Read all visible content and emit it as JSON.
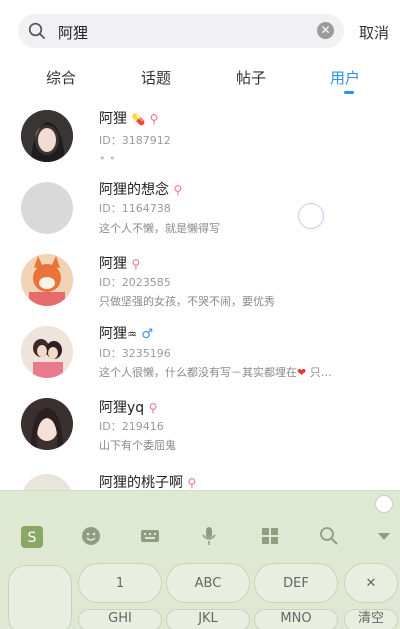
{
  "search": {
    "query": "阿狸",
    "cancel_label": "取消"
  },
  "tabs": [
    {
      "label": "综合",
      "active": false
    },
    {
      "label": "话题",
      "active": false
    },
    {
      "label": "帖子",
      "active": false
    },
    {
      "label": "用户",
      "active": true
    }
  ],
  "users": [
    {
      "name": "阿狸",
      "id": "ID：3187912",
      "bio": "",
      "gender": "female",
      "extra_icon": "pill-icon"
    },
    {
      "name": "阿狸的想念",
      "id": "ID：1164738",
      "bio": "这个人不懒，就是懒得写",
      "gender": "female"
    },
    {
      "name": "阿狸",
      "id": "ID：2023585",
      "bio": "只做坚强的女孩，不哭不闹，要优秀",
      "gender": "female"
    },
    {
      "name": "阿狸",
      "name_suffix": "♒",
      "id": "ID：3235196",
      "bio": "这个人很懒，什么都没有写－其实都埋在",
      "bio_tail": "只…",
      "gender": "male"
    },
    {
      "name": "阿狸yq",
      "id": "ID：219416",
      "bio": "山下有个委屈鬼",
      "gender": "female"
    },
    {
      "name": "阿狸的桃子啊",
      "id": "",
      "bio": "",
      "gender": "female"
    }
  ],
  "symbols": {
    "female": "⚲",
    "male": "♂",
    "heart": "❤",
    "pill": "💊",
    "clear": "✕",
    "chevron": "⌄",
    "row2_dots": "• •"
  },
  "keyboard": {
    "keys": [
      "1",
      "ABC",
      "DEF",
      "✕",
      "GHI",
      "JKL",
      "MNO",
      "清空"
    ]
  },
  "colors": {
    "accent": "#2e8ff0",
    "keyboard_bg": "#dfe8d3",
    "female": "#f06fa0",
    "male": "#3b8ee6"
  }
}
